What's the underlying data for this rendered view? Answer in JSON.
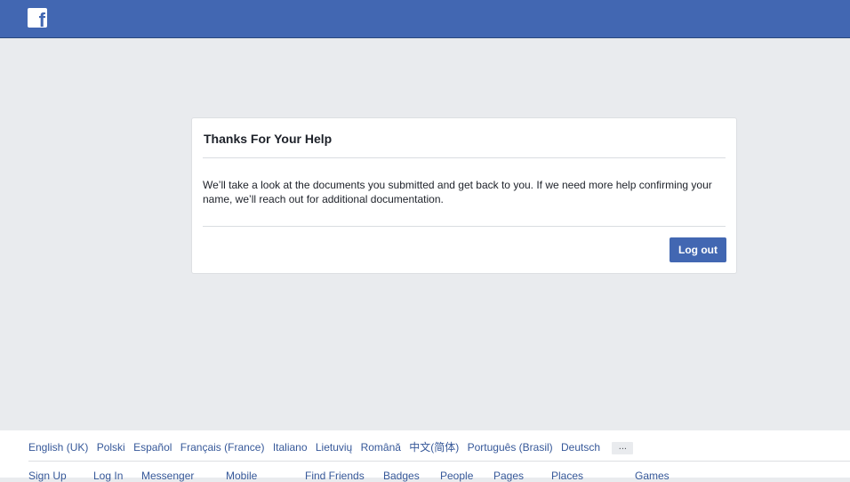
{
  "header": {
    "logo_glyph": "f"
  },
  "dialog": {
    "title": "Thanks For Your Help",
    "message": "We’ll take a look at the documents you submitted and get back to you. If we need more help confirming your name, we’ll reach out for additional documentation.",
    "logout_label": "Log out"
  },
  "footer": {
    "languages": [
      "English (UK)",
      "Polski",
      "Español",
      "Français (France)",
      "Italiano",
      "Lietuvių",
      "Română",
      "中文(简体)",
      "Português (Brasil)",
      "Deutsch"
    ],
    "more_label": "...",
    "links": [
      "Sign Up",
      "Log In",
      "Messenger",
      "Mobile",
      "Find Friends",
      "Badges",
      "People",
      "Pages",
      "Places",
      "Games"
    ]
  },
  "colors": {
    "brand": "#4267b2",
    "background": "#e9ebee",
    "link": "#365899"
  }
}
